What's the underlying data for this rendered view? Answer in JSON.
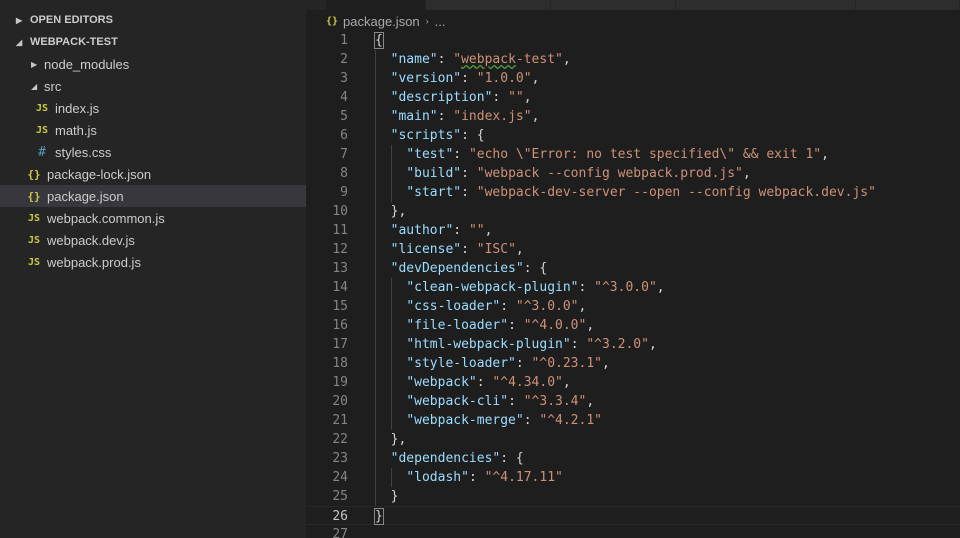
{
  "sidebar": {
    "open_editors_label": "OPEN EDITORS",
    "project_label": "WEBPACK-TEST",
    "items": [
      {
        "label": "node_modules",
        "kind": "folder",
        "expanded": false,
        "depth": 1
      },
      {
        "label": "src",
        "kind": "folder",
        "expanded": true,
        "depth": 1
      },
      {
        "label": "index.js",
        "kind": "js",
        "depth": 2
      },
      {
        "label": "math.js",
        "kind": "js",
        "depth": 2
      },
      {
        "label": "styles.css",
        "kind": "css",
        "depth": 2
      },
      {
        "label": "package-lock.json",
        "kind": "json",
        "depth": 1
      },
      {
        "label": "package.json",
        "kind": "json",
        "depth": 1,
        "selected": true
      },
      {
        "label": "webpack.common.js",
        "kind": "js",
        "depth": 1
      },
      {
        "label": "webpack.dev.js",
        "kind": "js",
        "depth": 1
      },
      {
        "label": "webpack.prod.js",
        "kind": "js",
        "depth": 1
      }
    ]
  },
  "icons": {
    "js": "JS",
    "json": "{}",
    "css": "#",
    "collapsed": "▶",
    "expanded": "◢"
  },
  "editor": {
    "breadcrumb": {
      "file": "package.json",
      "separator": "›",
      "ellipsis": "..."
    },
    "lines": [
      "{",
      "  \"name\": \"webpack-test\",",
      "  \"version\": \"1.0.0\",",
      "  \"description\": \"\",",
      "  \"main\": \"index.js\",",
      "  \"scripts\": {",
      "    \"test\": \"echo \\\"Error: no test specified\\\" && exit 1\",",
      "    \"build\": \"webpack --config webpack.prod.js\",",
      "    \"start\": \"webpack-dev-server --open --config webpack.dev.js\"",
      "  },",
      "  \"author\": \"\",",
      "  \"license\": \"ISC\",",
      "  \"devDependencies\": {",
      "    \"clean-webpack-plugin\": \"^3.0.0\",",
      "    \"css-loader\": \"^3.0.0\",",
      "    \"file-loader\": \"^4.0.0\",",
      "    \"html-webpack-plugin\": \"^3.2.0\",",
      "    \"style-loader\": \"^0.23.1\",",
      "    \"webpack\": \"^4.34.0\",",
      "    \"webpack-cli\": \"^3.3.4\",",
      "    \"webpack-merge\": \"^4.2.1\"",
      "  },",
      "  \"dependencies\": {",
      "    \"lodash\": \"^4.17.11\"",
      "  }",
      "}",
      ""
    ],
    "current_line": 26,
    "colors": {
      "key": "#9cdcfe",
      "string": "#ce9178",
      "punctuation": "#d4d4d4"
    }
  }
}
